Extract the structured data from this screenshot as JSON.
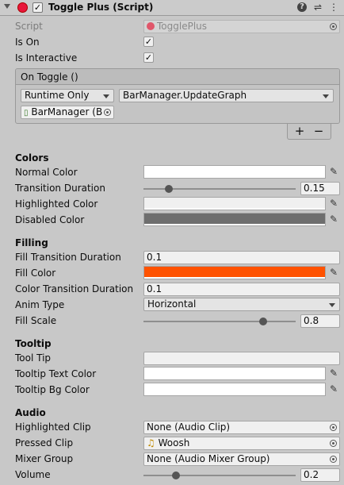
{
  "component": {
    "title": "Toggle Plus (Script)",
    "enabled": true,
    "header_icons": [
      "help-icon",
      "presets-icon",
      "context-menu-icon"
    ],
    "help_glyph": "?",
    "presets_glyph": "⇌",
    "menu_glyph": "⋮"
  },
  "fields": {
    "script_label": "Script",
    "script_value": "TogglePlus",
    "is_on_label": "Is On",
    "is_on": true,
    "is_interactive_label": "Is Interactive",
    "is_interactive": true
  },
  "on_toggle": {
    "title": "On Toggle ()",
    "runtime_option": "Runtime Only",
    "function": "BarManager.UpdateGraph",
    "target": "BarManager (B",
    "add_label": "+",
    "remove_label": "−"
  },
  "colors_section": {
    "title": "Colors",
    "normal_color_label": "Normal Color",
    "normal_color": "#ffffff",
    "transition_duration_label": "Transition Duration",
    "transition_duration": "0.15",
    "transition_duration_fraction": 0.15,
    "highlighted_color_label": "Highlighted Color",
    "highlighted_color": "#f0f0f0",
    "disabled_color_label": "Disabled Color",
    "disabled_color": "#6e6e6e"
  },
  "filling_section": {
    "title": "Filling",
    "fill_transition_duration_label": "Fill Transition Duration",
    "fill_transition_duration": "0.1",
    "fill_color_label": "Fill Color",
    "fill_color": "#ff5200",
    "color_transition_duration_label": "Color Transition Duration",
    "color_transition_duration": "0.1",
    "anim_type_label": "Anim Type",
    "anim_type": "Horizontal",
    "fill_scale_label": "Fill Scale",
    "fill_scale": "0.8",
    "fill_scale_fraction": 0.8
  },
  "tooltip_section": {
    "title": "Tooltip",
    "tool_tip_label": "Tool Tip",
    "tool_tip": "",
    "text_color_label": "Tooltip Text Color",
    "text_color": "#ffffff",
    "bg_color_label": "Tooltip Bg Color",
    "bg_color": "#ffffff"
  },
  "audio_section": {
    "title": "Audio",
    "highlighted_clip_label": "Highlighted Clip",
    "highlighted_clip": "None (Audio Clip)",
    "pressed_clip_label": "Pressed Clip",
    "pressed_clip": "Woosh",
    "mixer_group_label": "Mixer Group",
    "mixer_group": "None (Audio Mixer Group)",
    "volume_label": "Volume",
    "volume": "0.2",
    "volume_fraction": 0.2
  },
  "glyphs": {
    "check": "✓",
    "eyedropper": "✎",
    "music_note": "♫",
    "script_file": "▯"
  }
}
